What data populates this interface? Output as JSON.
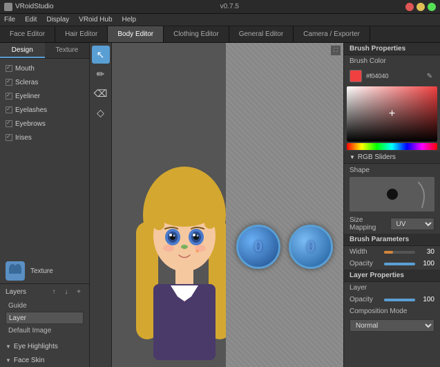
{
  "app": {
    "title": "VRoid Studio",
    "version": "v0.7.5"
  },
  "titlebar": {
    "app_name": "VRoidStudio",
    "version": "v0.7.5"
  },
  "menubar": {
    "items": [
      "File",
      "Edit",
      "Display",
      "VRoid Hub",
      "Help"
    ]
  },
  "tabs": [
    {
      "label": "Face Editor",
      "active": false
    },
    {
      "label": "Hair Editor",
      "active": false
    },
    {
      "label": "Body Editor",
      "active": true
    },
    {
      "label": "Clothing Editor",
      "active": false
    },
    {
      "label": "General Editor",
      "active": false
    },
    {
      "label": "Camera / Exporter",
      "active": false
    }
  ],
  "left_panel": {
    "subtabs": [
      {
        "label": "Design",
        "active": true
      },
      {
        "label": "Texture",
        "active": false
      }
    ],
    "items": [
      {
        "label": "Mouth",
        "checked": true
      },
      {
        "label": "Scleras",
        "checked": true
      },
      {
        "label": "Eyeliner",
        "checked": true
      },
      {
        "label": "Eyelashes",
        "checked": true
      },
      {
        "label": "Eyebrows",
        "checked": true
      },
      {
        "label": "Irises",
        "checked": true
      }
    ],
    "texture_label": "Texture",
    "layers": {
      "title": "Layers",
      "items": [
        {
          "label": "Guide"
        },
        {
          "label": "Layer",
          "editable": true
        },
        {
          "label": "Default Image"
        }
      ]
    },
    "bottom_items": [
      {
        "label": "Eye Highlights"
      },
      {
        "label": "Face Skin"
      }
    ]
  },
  "tools": [
    {
      "icon": "cursor",
      "name": "select-tool",
      "active": true,
      "unicode": "↖"
    },
    {
      "icon": "pencil",
      "name": "pencil-tool",
      "active": false,
      "unicode": "✏"
    },
    {
      "icon": "eraser",
      "name": "eraser-tool",
      "active": false,
      "unicode": "⌫"
    },
    {
      "icon": "dropper",
      "name": "dropper-tool",
      "active": false,
      "unicode": "◇"
    }
  ],
  "right_panel": {
    "brush_properties_title": "Brush Properties",
    "brush_color_label": "Brush Color",
    "color_hex": "#f04040",
    "rgb_sliders_label": "RGB Sliders",
    "shape_label": "Shape",
    "size_mapping_label": "Size Mapping",
    "size_mapping_value": "UV",
    "brush_parameters_title": "Brush Parameters",
    "width_label": "Width",
    "width_value": "30",
    "width_percent": 30,
    "opacity_label": "Opacity",
    "opacity_value": "100",
    "opacity_percent": 100,
    "layer_properties_title": "Layer Properties",
    "layer_label": "Layer",
    "layer_opacity_label": "Opacity",
    "layer_opacity_value": "100",
    "layer_opacity_percent": 100,
    "composition_mode_label": "Composition Mode",
    "composition_mode_value": "Normal"
  }
}
